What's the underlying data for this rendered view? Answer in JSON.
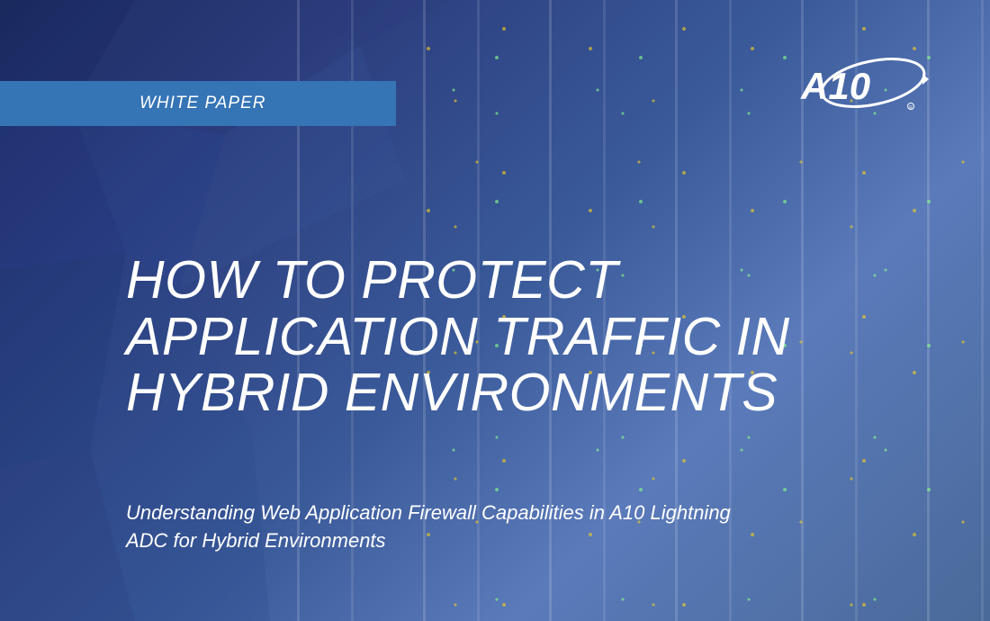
{
  "document": {
    "badge_label": "WHITE PAPER",
    "title": "HOW TO PROTECT APPLICATION TRAFFIC IN HYBRID ENVIRONMENTS",
    "subtitle": "Understanding Web Application Firewall Capabilities in A10 Lightning ADC for Hybrid Environments",
    "brand": "A10"
  },
  "colors": {
    "badge_bg": "#3574b5",
    "text": "#ffffff"
  }
}
